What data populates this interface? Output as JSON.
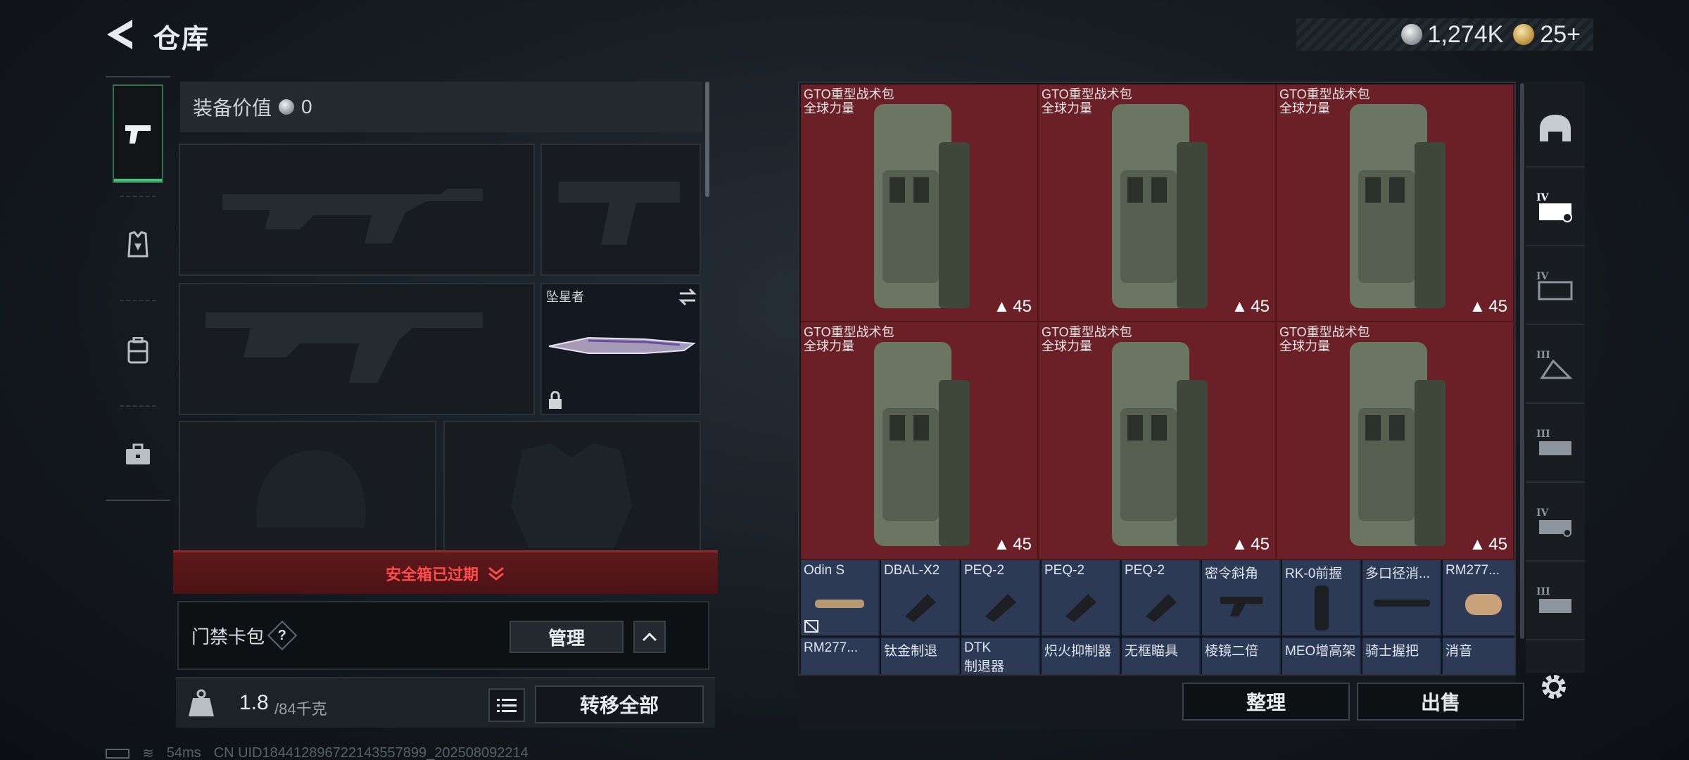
{
  "header": {
    "title": "仓库",
    "currency": [
      {
        "icon": "silver-coin-icon",
        "value": "1,274K"
      },
      {
        "icon": "gold-coin-icon",
        "value": "25+"
      }
    ]
  },
  "left_tabs": [
    {
      "icon": "pistol-icon",
      "active": true
    },
    {
      "icon": "armor-vest-icon",
      "active": false
    },
    {
      "icon": "backpack-icon",
      "active": false
    },
    {
      "icon": "toolbox-icon",
      "active": false
    }
  ],
  "loadout": {
    "equip_value_label": "装备价值",
    "equip_value": "0",
    "melee_name": "坠星者",
    "safebox_warning": "安全箱已过期",
    "keycard_label": "门禁卡包",
    "keycard_help": "?",
    "manage_label": "管理",
    "weight_current": "1.8",
    "weight_max": "/84千克",
    "transfer_all_label": "转移全部"
  },
  "stash": {
    "bags": [
      {
        "name": "GTO重型战术包",
        "brand": "全球力量",
        "count": "45"
      },
      {
        "name": "GTO重型战术包",
        "brand": "全球力量",
        "count": "45"
      },
      {
        "name": "GTO重型战术包",
        "brand": "全球力量",
        "count": "45"
      },
      {
        "name": "GTO重型战术包",
        "brand": "全球力量",
        "count": "45"
      },
      {
        "name": "GTO重型战术包",
        "brand": "全球力量",
        "count": "45"
      },
      {
        "name": "GTO重型战术包",
        "brand": "全球力量",
        "count": "45"
      }
    ],
    "items_row1": [
      "Odin S",
      "DBAL-X2",
      "PEQ-2",
      "PEQ-2",
      "PEQ-2",
      "密令斜角",
      "RK-0前握",
      "多口径消...",
      "RM277..."
    ],
    "items_row2": [
      {
        "name": "RM277...",
        "name2": ""
      },
      {
        "name": "钛金制退",
        "name2": ""
      },
      {
        "name": "DTK",
        "name2": "制退器"
      },
      {
        "name": "炽火抑制器",
        "name2": ""
      },
      {
        "name": "无框瞄具",
        "name2": ""
      },
      {
        "name": "棱镜二倍",
        "name2": ""
      },
      {
        "name": "MEO增高架",
        "name2": ""
      },
      {
        "name": "骑士握把",
        "name2": ""
      },
      {
        "name": "消音",
        "name2": ""
      }
    ],
    "sort_label": "整理",
    "sell_label": "出售"
  },
  "right_tabs": [
    {
      "icon": "helmet-icon"
    },
    {
      "icon": "tier-iv-vest-icon"
    },
    {
      "icon": "tier-iv-rig-icon"
    },
    {
      "icon": "tier-iii-bag-icon"
    },
    {
      "icon": "tier-iii-rig-icon"
    },
    {
      "icon": "tier-iv-weapon-icon"
    },
    {
      "icon": "tier-iii-weapon-icon"
    }
  ],
  "status": {
    "ping": "54ms",
    "uid": "CN UID1844128967221435578​99_202508092214"
  },
  "colors": {
    "bag_bg": "#6b2027",
    "small_item_bg": "#2d3a55",
    "warning_red": "#ff4b4b",
    "active_green": "#49c27e"
  }
}
